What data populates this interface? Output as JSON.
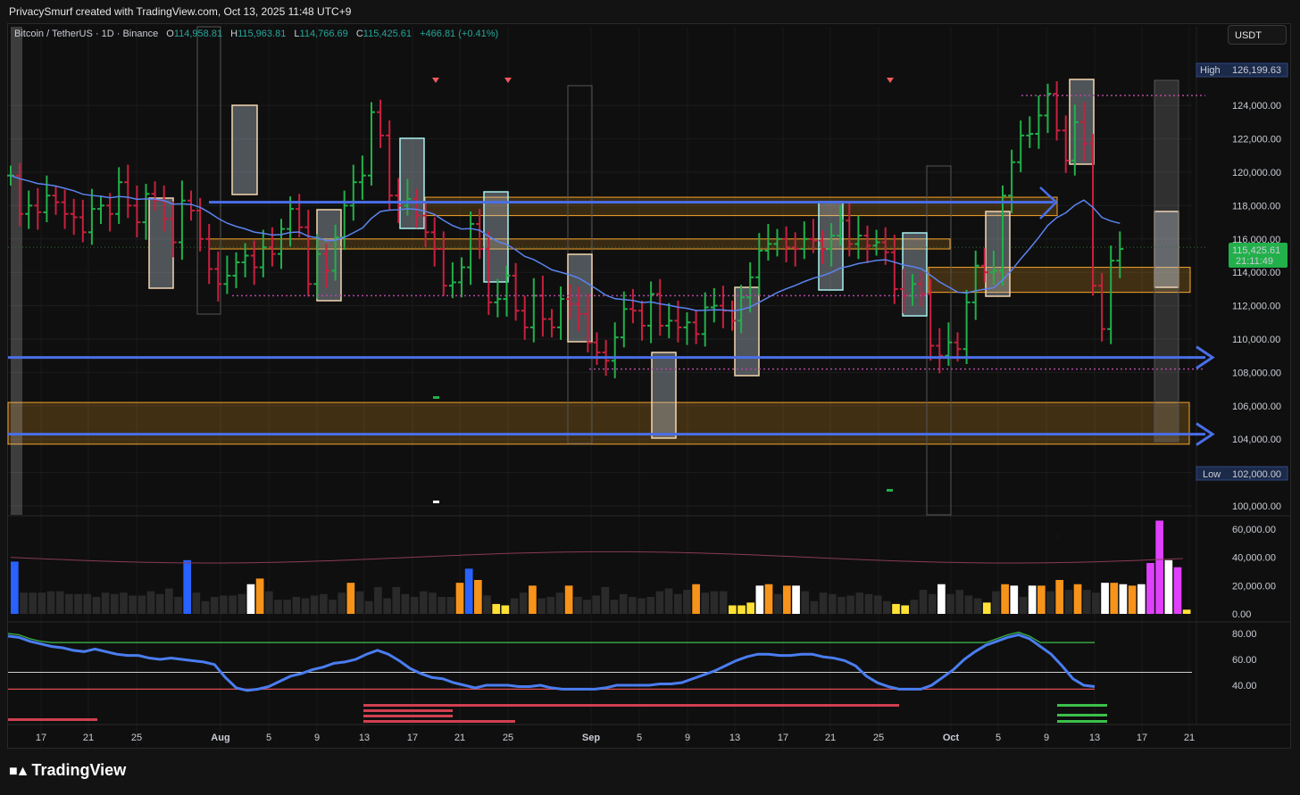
{
  "header": {
    "attribution": "PrivacySmurf created with TradingView.com, Oct 13, 2025 11:48 UTC+9"
  },
  "legend": {
    "symbol": "Bitcoin / TetherUS · 1D · Binance",
    "o_label": "O",
    "o_value": "114,958.81",
    "h_label": "H",
    "h_value": "115,963.81",
    "l_label": "L",
    "l_value": "114,766.69",
    "c_label": "C",
    "c_value": "115,425.61",
    "change": "+466.81 (+0.41%)"
  },
  "currency_button": "USDT",
  "price_tags": {
    "high_label": "High",
    "high_value": "126,199.63",
    "low_label": "Low",
    "low_value": "102,000.00",
    "last_value": "115,425.61",
    "countdown": "21:11:49"
  },
  "logo": {
    "text": "TradingView"
  },
  "colors": {
    "up": "#26a69a",
    "up_bar": "#22b04a",
    "down": "#c8203f",
    "blue_line": "#4a6fe8",
    "orange_zone": "#f7a52b",
    "ma": "#5b84f0",
    "osc": "#4a7df0"
  },
  "chart_data": [
    {
      "type": "ohlc",
      "title": "Bitcoin / TetherUS · 1D · Binance",
      "ylim": [
        100000,
        127000
      ],
      "y_ticks": [
        "100,000.00",
        "102,000.00",
        "104,000.00",
        "106,000.00",
        "108,000.00",
        "110,000.00",
        "112,000.00",
        "114,000.00",
        "116,000.00",
        "118,000.00",
        "120,000.00",
        "122,000.00",
        "124,000.00"
      ],
      "x_labels": [
        "17",
        "21",
        "25",
        "Aug",
        "5",
        "9",
        "13",
        "17",
        "21",
        "25",
        "Sep",
        "5",
        "9",
        "13",
        "17",
        "21",
        "25",
        "Oct",
        "5",
        "9",
        "13",
        "17",
        "21"
      ],
      "closes": [
        119800,
        117500,
        118000,
        117600,
        118600,
        118200,
        117500,
        117300,
        116400,
        117800,
        118000,
        117500,
        119400,
        118000,
        117000,
        118700,
        118300,
        117200,
        115800,
        118300,
        117700,
        116000,
        114200,
        113300,
        113800,
        114600,
        115000,
        114300,
        115500,
        115100,
        116600,
        117800,
        116700,
        113300,
        115100,
        114100,
        116100,
        118000,
        119400,
        119800,
        123600,
        122200,
        118600,
        118000,
        118400,
        117400,
        116400,
        115400,
        113200,
        113400,
        114300,
        116900,
        115400,
        112200,
        112400,
        113800,
        111700,
        110700,
        112600,
        111200,
        110700,
        112400,
        112100,
        111500,
        109800,
        109200,
        108700,
        110100,
        111800,
        111700,
        110800,
        112700,
        110800,
        111100,
        110700,
        111000,
        110300,
        111900,
        112000,
        111700,
        111100,
        112500,
        113700,
        115300,
        115700,
        116000,
        115500,
        115400,
        116000,
        115900,
        115400,
        116200,
        117100,
        115700,
        116200,
        115600,
        115800,
        115200,
        113000,
        112600,
        113300,
        112700,
        109600,
        109000,
        109800,
        109400,
        112200,
        114400,
        114000,
        114100,
        118600,
        120600,
        122200,
        122300,
        123400,
        124700,
        122500,
        120700,
        123000,
        121700,
        113200,
        110600,
        114700,
        115400
      ],
      "annotations": {
        "high": "126,199.63",
        "low": "102,000.00",
        "last": "115,425.61"
      }
    },
    {
      "type": "bar",
      "title": "Volume",
      "ylim": [
        0,
        65000
      ],
      "y_ticks": [
        "0.00",
        "20,000.00",
        "40,000.00",
        "60,000.00"
      ],
      "values": [
        37000,
        15000,
        15000,
        15000,
        16000,
        16000,
        14000,
        14000,
        14000,
        12000,
        15000,
        14000,
        15000,
        13000,
        13000,
        16000,
        14000,
        18000,
        12000,
        38000,
        15000,
        9000,
        12000,
        13000,
        13000,
        14000,
        21000,
        25000,
        16000,
        10000,
        10000,
        12000,
        11000,
        13000,
        14000,
        10000,
        15000,
        22000,
        16000,
        9000,
        19000,
        11000,
        19000,
        14000,
        12000,
        16000,
        15000,
        12000,
        12000,
        22000,
        32000,
        24000,
        13000,
        7000,
        6000,
        11000,
        15000,
        20000,
        11000,
        12000,
        15000,
        20000,
        12000,
        10000,
        13000,
        19000,
        10000,
        14000,
        12000,
        11000,
        12000,
        16000,
        18000,
        14000,
        17000,
        21000,
        15000,
        16000,
        16000,
        6000,
        6000,
        8000,
        20000,
        21000,
        14000,
        20000,
        20000,
        16000,
        9000,
        15000,
        14000,
        12000,
        13000,
        15000,
        14000,
        13000,
        9000,
        7000,
        6000,
        10000,
        17000,
        14000,
        21000,
        14000,
        17000,
        13000,
        11000,
        8000,
        16000,
        21000,
        20000,
        12000,
        20000,
        20000,
        16000,
        24000,
        17000,
        21000,
        17000,
        15000,
        22000,
        22000,
        21000,
        20000,
        21000,
        36000,
        66000,
        38000,
        33000,
        3000
      ]
    },
    {
      "type": "line",
      "title": "Oscillator",
      "ylim": [
        33,
        85
      ],
      "y_ticks": [
        "40.00",
        "60.00",
        "80.00"
      ],
      "values": [
        78,
        77,
        74,
        72,
        70,
        69,
        67,
        66,
        68,
        66,
        64,
        63,
        63,
        61,
        60,
        61,
        60,
        59,
        58,
        56,
        46,
        38,
        36,
        37,
        39,
        43,
        47,
        49,
        52,
        54,
        57,
        58,
        60,
        64,
        67,
        64,
        59,
        53,
        49,
        46,
        45,
        42,
        40,
        38,
        40,
        40,
        40,
        39,
        39,
        40,
        38,
        37,
        37,
        37,
        37,
        38,
        40,
        40,
        40,
        40,
        41,
        41,
        42,
        45,
        48,
        51,
        55,
        59,
        62,
        64,
        64,
        63,
        63,
        64,
        64,
        62,
        61,
        59,
        55,
        47,
        42,
        39,
        37,
        37,
        37,
        40,
        46,
        52,
        60,
        66,
        71,
        74,
        77,
        79,
        76,
        70,
        64,
        55,
        45,
        40,
        39
      ],
      "levels": [
        40,
        50
      ]
    }
  ]
}
